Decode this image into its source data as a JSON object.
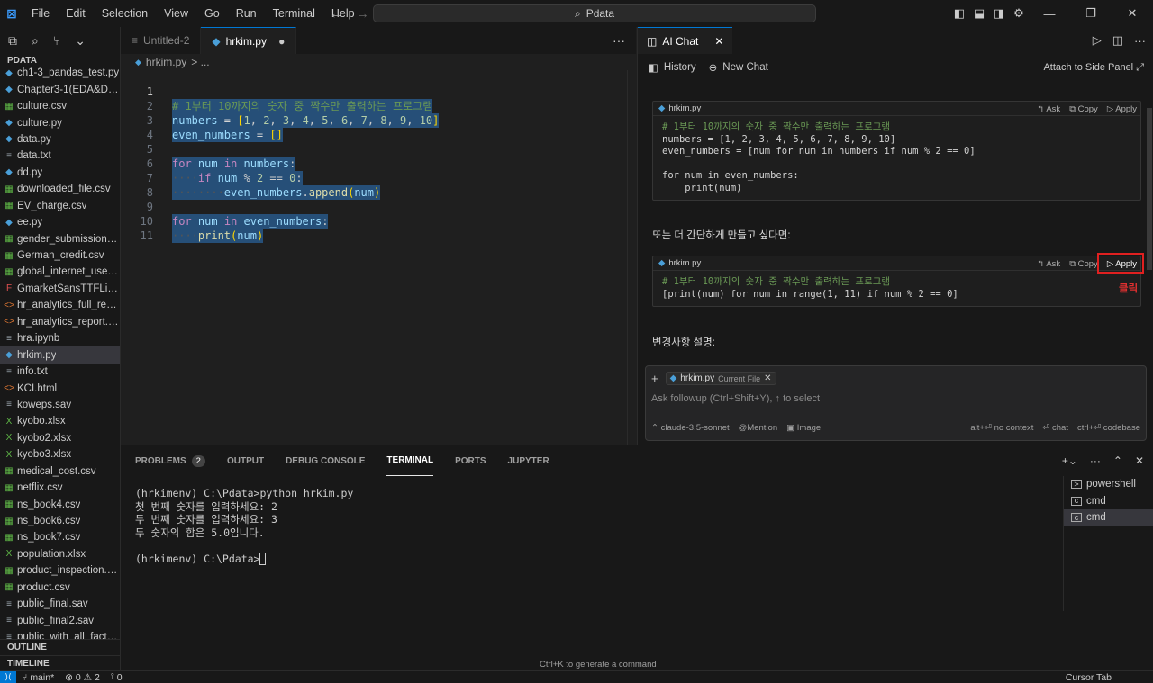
{
  "titlebar": {
    "app_icon": "vscode-logo",
    "menu": [
      "File",
      "Edit",
      "Selection",
      "View",
      "Go",
      "Run",
      "Terminal",
      "Help"
    ],
    "search_text": "Pdata",
    "nav_back": "←",
    "nav_forward": "→"
  },
  "sidebar": {
    "explorer_title": "PDATA",
    "files": [
      {
        "name": "ch1-3_pandas_test.py",
        "type": "py"
      },
      {
        "name": "Chapter3-1(EDA&Des...",
        "type": "py"
      },
      {
        "name": "culture.csv",
        "type": "csv"
      },
      {
        "name": "culture.py",
        "type": "py"
      },
      {
        "name": "data.py",
        "type": "py"
      },
      {
        "name": "data.txt",
        "type": "txt"
      },
      {
        "name": "dd.py",
        "type": "py"
      },
      {
        "name": "downloaded_file.csv",
        "type": "csv"
      },
      {
        "name": "EV_charge.csv",
        "type": "csv"
      },
      {
        "name": "ee.py",
        "type": "py"
      },
      {
        "name": "gender_submission.csv",
        "type": "csv"
      },
      {
        "name": "German_credit.csv",
        "type": "csv"
      },
      {
        "name": "global_internet_users....",
        "type": "csv"
      },
      {
        "name": "GmarketSansTTFLight...",
        "type": "font"
      },
      {
        "name": "hr_analytics_full_repor...",
        "type": "html"
      },
      {
        "name": "hr_analytics_report.ht...",
        "type": "html"
      },
      {
        "name": "hra.ipynb",
        "type": "txt"
      },
      {
        "name": "hrkim.py",
        "type": "py",
        "active": true
      },
      {
        "name": "info.txt",
        "type": "txt"
      },
      {
        "name": "KCI.html",
        "type": "html"
      },
      {
        "name": "koweps.sav",
        "type": "txt"
      },
      {
        "name": "kyobo.xlsx",
        "type": "xlsx"
      },
      {
        "name": "kyobo2.xlsx",
        "type": "xlsx"
      },
      {
        "name": "kyobo3.xlsx",
        "type": "xlsx"
      },
      {
        "name": "medical_cost.csv",
        "type": "csv"
      },
      {
        "name": "netflix.csv",
        "type": "csv"
      },
      {
        "name": "ns_book4.csv",
        "type": "csv"
      },
      {
        "name": "ns_book6.csv",
        "type": "csv"
      },
      {
        "name": "ns_book7.csv",
        "type": "csv"
      },
      {
        "name": "population.xlsx",
        "type": "xlsx"
      },
      {
        "name": "product_inspection.csv",
        "type": "csv"
      },
      {
        "name": "product.csv",
        "type": "csv"
      },
      {
        "name": "public_final.sav",
        "type": "txt"
      },
      {
        "name": "public_final2.sav",
        "type": "txt"
      },
      {
        "name": "public_with_all_factor...",
        "type": "txt"
      }
    ],
    "outline_label": "OUTLINE",
    "timeline_label": "TIMELINE"
  },
  "editor": {
    "tabs": [
      {
        "label": "Untitled-2",
        "active": false
      },
      {
        "label": "hrkim.py",
        "active": true
      }
    ],
    "breadcrumb_file": "hrkim.py",
    "breadcrumb_sep": "> ...",
    "line_numbers": [
      "1",
      "2",
      "3",
      "4",
      "5",
      "6",
      "7",
      "8",
      "9",
      "10",
      "11"
    ],
    "line1_comment": "# 1부터 10까지의 숫자 중 짝수만 출력하는 프로그램",
    "more": "···"
  },
  "chat": {
    "tab_label": "AI Chat",
    "history_label": "History",
    "new_chat_label": "New Chat",
    "attach_label": "Attach to Side Panel",
    "block1": {
      "filename": "hrkim.py",
      "ask": "Ask",
      "copy": "Copy",
      "apply": "Apply",
      "code": "# 1부터 10까지의 숫자 중 짝수만 출력하는 프로그램\nnumbers = [1, 2, 3, 4, 5, 6, 7, 8, 9, 10]\neven_numbers = [num for num in numbers if num % 2 == 0]\n\nfor num in even_numbers:\n    print(num)"
    },
    "text_between": "또는 더 간단하게 만들고 싶다면:",
    "block2": {
      "filename": "hrkim.py",
      "ask": "Ask",
      "copy": "Copy",
      "apply": "Apply",
      "code": "# 1부터 10까지의 숫자 중 짝수만 출력하는 프로그램\n[print(num) for num in range(1, 11) if num % 2 == 0]"
    },
    "click_annotation": "클릭",
    "changes_heading": "변경사항 설명:",
    "input": {
      "chip_file": "hrkim.py",
      "chip_tag": "Current File",
      "placeholder": "Ask followup (Ctrl+Shift+Y), ↑ to select",
      "model": "claude-3.5-sonnet",
      "mention": "Mention",
      "image": "Image",
      "no_context": "alt+⏎ no context",
      "chat": "⏎ chat",
      "codebase": "ctrl+⏎ codebase"
    }
  },
  "panel": {
    "tabs": [
      {
        "label": "PROBLEMS",
        "badge": "2"
      },
      {
        "label": "OUTPUT"
      },
      {
        "label": "DEBUG CONSOLE"
      },
      {
        "label": "TERMINAL",
        "active": true
      },
      {
        "label": "PORTS"
      },
      {
        "label": "JUPYTER"
      }
    ],
    "terminal_lines": [
      "(hrkimenv) C:\\Pdata>python hrkim.py",
      "첫 번째 숫자를 입력하세요: 2",
      "두 번째 숫자를 입력하세요: 3",
      "두 숫자의 합은 5.0입니다.",
      "",
      "(hrkimenv) C:\\Pdata>"
    ],
    "terminals": [
      "powershell",
      "cmd",
      "cmd"
    ],
    "ctrl_k_hint": "Ctrl+K to generate a command"
  },
  "statusbar": {
    "branch": "main*",
    "errors": "⊗ 0 ⚠ 2",
    "ports": "0",
    "cursor_tab": "Cursor Tab"
  },
  "colors": {
    "accent": "#0078d4",
    "annotation_red": "#e02020",
    "selection": "#264f78"
  }
}
